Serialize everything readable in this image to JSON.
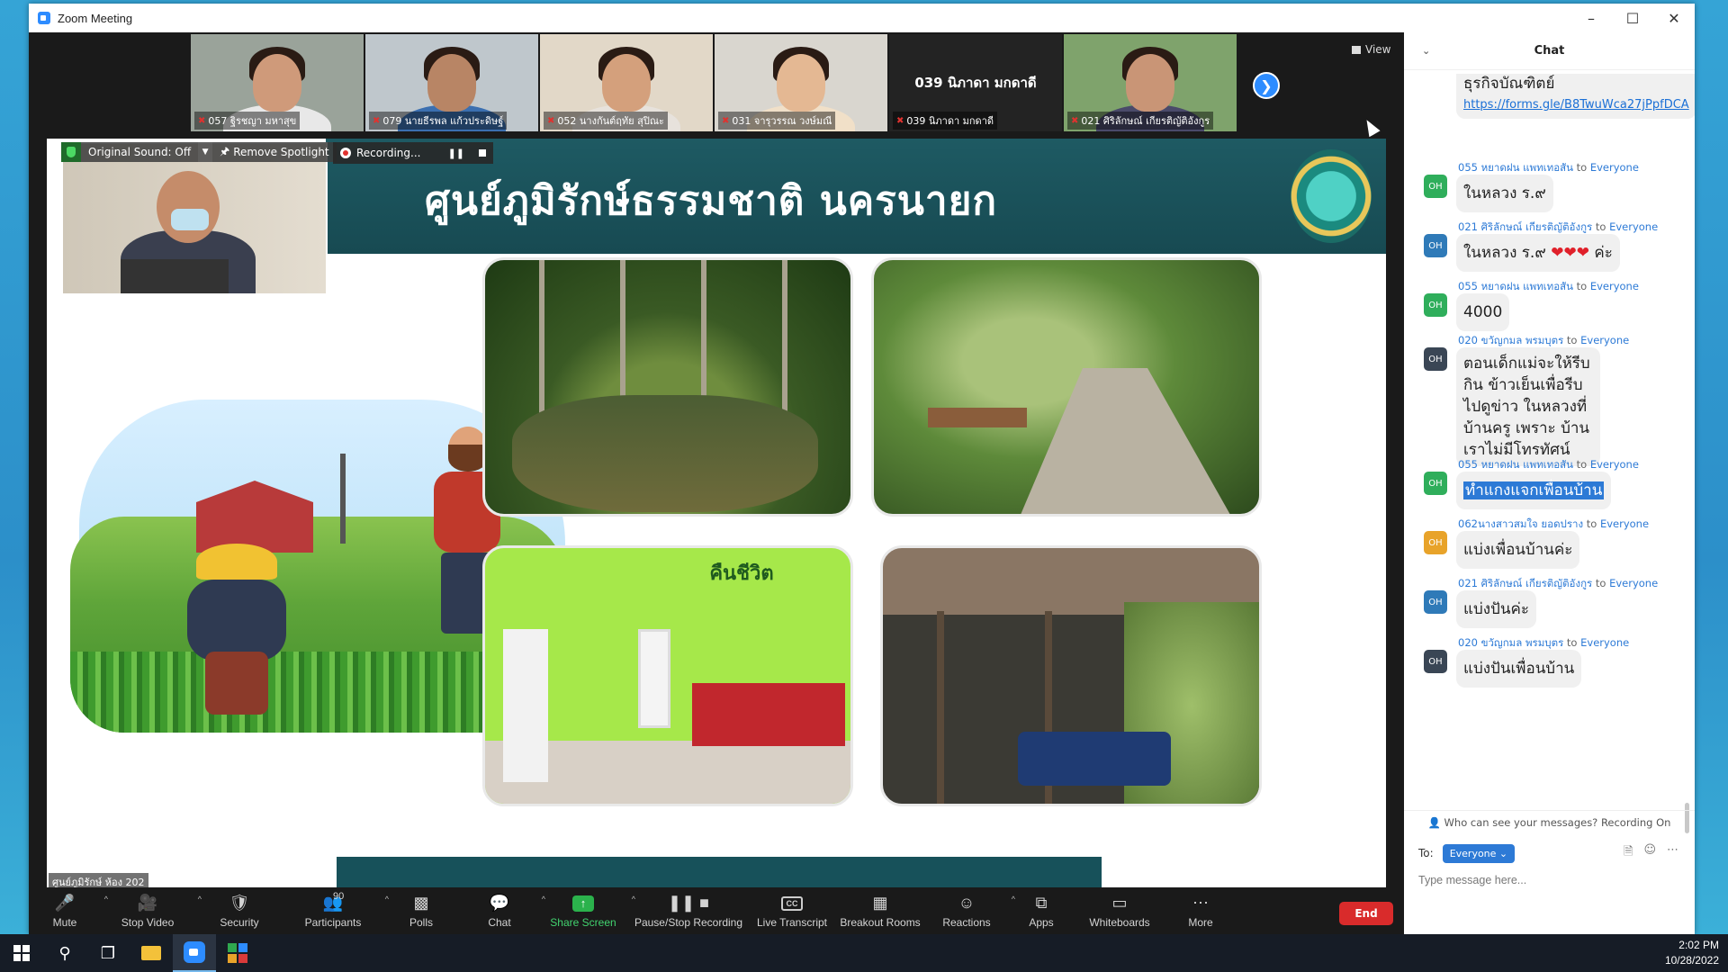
{
  "window": {
    "title": "Zoom Meeting"
  },
  "gallery": {
    "tiles": [
      {
        "label": "057 ฐิรชญา มหาสุข",
        "skin": "#cf9a7a",
        "shirt": "#e8e8e8",
        "bg": "#9aa39a"
      },
      {
        "label": "079 นายธีรพล แก้วประดิษฐ์",
        "skin": "#b88565",
        "shirt": "#3b6fb0",
        "bg": "#bfc7cc"
      },
      {
        "label": "052 นางกันต์ฤทัย สุปิณะ",
        "skin": "#d4a07c",
        "shirt": "#e7e2dc",
        "bg": "#e2d8c8"
      },
      {
        "label": "031 จารุวรรณ วงษ์มณี",
        "skin": "#e4b893",
        "shirt": "#f1e0c8",
        "bg": "#d9d6cf"
      },
      {
        "label": "039 นิภาดา มกดาดี",
        "bigname": "039 นิภาดา มกดาดี"
      },
      {
        "label": "021 ศิริลักษณ์ เกียรติญัติอังกูร",
        "skin": "#c99576",
        "shirt": "#4a4a6a",
        "bg": "#7fa36c"
      }
    ],
    "view_label": "View"
  },
  "spotlight": {
    "original_sound": "Original Sound: Off",
    "remove_spotlight": "Remove Spotlight"
  },
  "recording": {
    "label": "Recording..."
  },
  "slide": {
    "title": "ศูนย์ภูมิรักษ์ธรรมชาติ นครนายก",
    "shop_sign": "คืนชีวิต"
  },
  "room_label": "ศูนย์ภูมิรักษ์ ห้อง 202",
  "toolbar": {
    "mute": "Mute",
    "stop_video": "Stop Video",
    "security": "Security",
    "participants": "Participants",
    "participants_count": "90",
    "polls": "Polls",
    "chat": "Chat",
    "share_screen": "Share Screen",
    "pause_stop_recording": "Pause/Stop Recording",
    "live_transcript": "Live Transcript",
    "breakout_rooms": "Breakout Rooms",
    "reactions": "Reactions",
    "apps": "Apps",
    "whiteboards": "Whiteboards",
    "more": "More",
    "end": "End"
  },
  "chat": {
    "title": "Chat",
    "to_word": "to",
    "messages": [
      {
        "sender": "",
        "target": "",
        "text": "ธุรกิจบัณฑิตย์",
        "link": "https://forms.gle/B8TwuWca27jPpfDCA",
        "avatar": "",
        "avatar_color": ""
      },
      {
        "sender": "055 หยาดฝน แพทเทอสัน",
        "target": "Everyone",
        "text": "ในหลวง ร.๙",
        "avatar": "OH",
        "avatar_color": "#2fae5b"
      },
      {
        "sender": "021 ศิริลักษณ์ เกียรติญัติอังกูร",
        "target": "Everyone",
        "text": "ในหลวง ร.๙",
        "hearts": "❤❤❤",
        "suffix": " ค่ะ",
        "avatar": "OH",
        "avatar_color": "#2f7ab8"
      },
      {
        "sender": "055 หยาดฝน แพทเทอสัน",
        "target": "Everyone",
        "text": "4000",
        "avatar": "OH",
        "avatar_color": "#2fae5b"
      },
      {
        "sender": "020 ขวัญกมล พรมบุตร",
        "target": "Everyone",
        "text": "ตอนเด็กแม่จะให้รีบกิน ข้าวเย็นเพื่อรีบไปดูข่าว ในหลวงที่บ้านครู เพราะ บ้านเราไม่มีโทรทัศน์",
        "avatar": "OH",
        "avatar_color": "#3a4655"
      },
      {
        "sender": "055 หยาดฝน แพทเทอสัน",
        "target": "Everyone",
        "text": "ทำแกงแจกเพื่อนบ้าน",
        "avatar": "OH",
        "avatar_color": "#2fae5b",
        "selected": true
      },
      {
        "sender": "062นางสาวสมใจ ยอดปราง",
        "target": "Everyone",
        "text": "แบ่งเพื่อนบ้านค่ะ",
        "avatar": "OH",
        "avatar_color": "#e8a32a"
      },
      {
        "sender": "021 ศิริลักษณ์ เกียรติญัติอังกูร",
        "target": "Everyone",
        "text": "แบ่งปันค่ะ",
        "avatar": "OH",
        "avatar_color": "#2f7ab8"
      },
      {
        "sender": "020 ขวัญกมล พรมบุตร",
        "target": "Everyone",
        "text": "แบ่งปันเพื่อนบ้าน",
        "avatar": "OH",
        "avatar_color": "#3a4655"
      }
    ],
    "who_can_see": "Who can see your messages? Recording On",
    "to_label": "To:",
    "to_value": "Everyone",
    "input_placeholder": "Type message here..."
  },
  "taskbar": {
    "time": "2:02 PM",
    "date": "10/28/2022"
  }
}
